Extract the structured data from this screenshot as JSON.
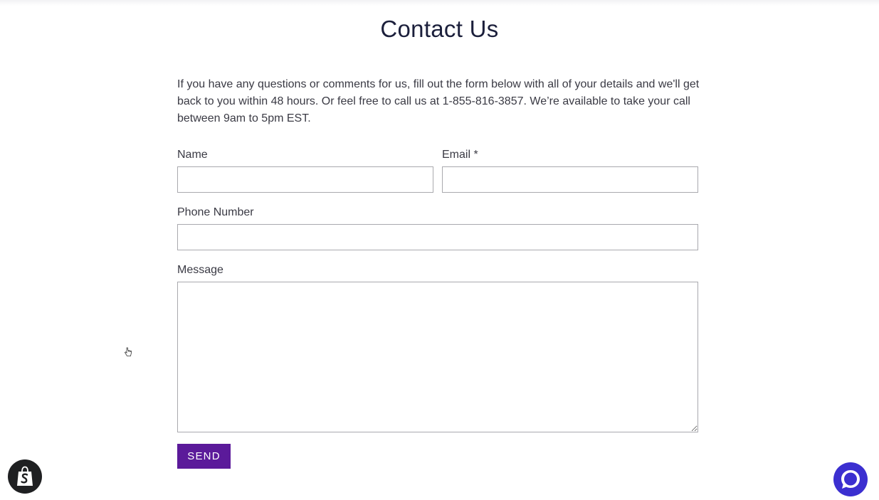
{
  "page": {
    "title": "Contact Us",
    "intro": "If you have any questions or comments for us, fill out the form below with all of your details and we'll get back to you within 48 hours. Or feel free to call us at 1-855-816-3857. We’re available to take your call between 9am to 5pm EST."
  },
  "form": {
    "name_label": "Name",
    "name_value": "",
    "email_label": "Email *",
    "email_value": "",
    "phone_label": "Phone Number",
    "phone_value": "",
    "message_label": "Message",
    "message_value": "",
    "send_label": "SEND"
  },
  "widgets": {
    "shop_icon": "shopify-bag-icon",
    "chat_icon": "chat-bubble-icon"
  },
  "colors": {
    "title": "#1b1f3b",
    "send_button": "#5b1a9a",
    "chat_button": "#3b2fd0",
    "shop_badge": "#1f2022"
  }
}
